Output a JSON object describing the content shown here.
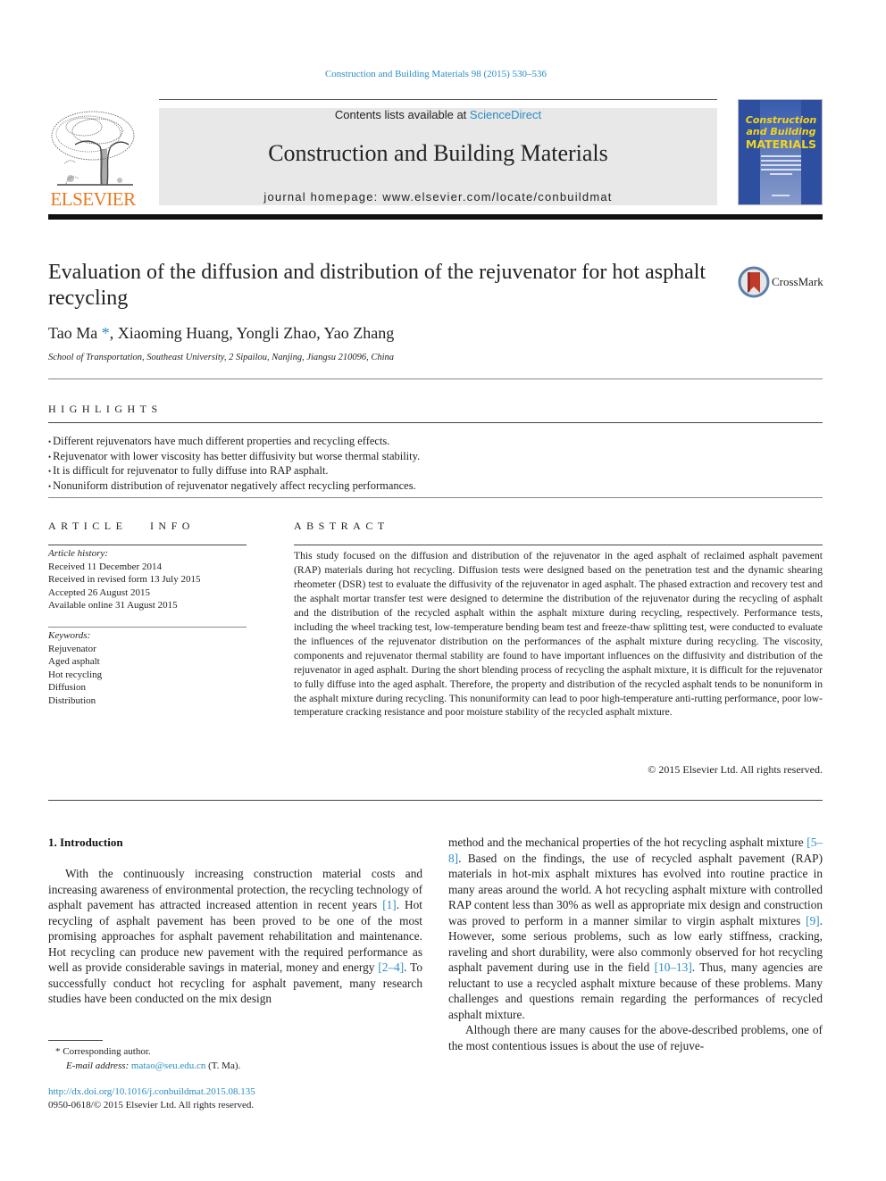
{
  "journal_citation": "Construction and Building Materials 98 (2015) 530–536",
  "header": {
    "publisher_logo_text": "ELSEVIER",
    "contents_prefix": "Contents lists available at ",
    "contents_link": "ScienceDirect",
    "journal_title": "Construction and Building Materials",
    "homepage_label": "journal homepage: ",
    "homepage_url": "www.elsevier.com/locate/conbuildmat",
    "cover_line1": "Construction",
    "cover_line2": "and Building",
    "cover_line3": "MATERIALS"
  },
  "article": {
    "title": "Evaluation of the diffusion and distribution of the rejuvenator for hot asphalt recycling",
    "crossmark_label": "CrossMark",
    "authors_first": "Tao Ma",
    "author_mark": "*",
    "authors_rest": ", Xiaoming Huang, Yongli Zhao, Yao Zhang",
    "affiliation": "School of Transportation, Southeast University, 2 Sipailou, Nanjing, Jiangsu 210096, China"
  },
  "highlights": {
    "heading": "HIGHLIGHTS",
    "items": [
      "Different rejuvenators have much different properties and recycling effects.",
      "Rejuvenator with lower viscosity has better diffusivity but worse thermal stability.",
      "It is difficult for rejuvenator to fully diffuse into RAP asphalt.",
      "Nonuniform distribution of rejuvenator negatively affect recycling performances."
    ]
  },
  "article_info": {
    "heading": "ARTICLE   INFO",
    "history_label": "Article history:",
    "history": [
      "Received 11 December 2014",
      "Received in revised form 13 July 2015",
      "Accepted 26 August 2015",
      "Available online 31 August 2015"
    ],
    "keywords_label": "Keywords:",
    "keywords": [
      "Rejuvenator",
      "Aged asphalt",
      "Hot recycling",
      "Diffusion",
      "Distribution"
    ]
  },
  "abstract": {
    "heading": "ABSTRACT",
    "text": "This study focused on the diffusion and distribution of the rejuvenator in the aged asphalt of reclaimed asphalt pavement (RAP) materials during hot recycling. Diffusion tests were designed based on the pen­etration test and the dynamic shearing rheometer (DSR) test to evaluate the diffusivity of the rejuvenator in aged asphalt. The phased extraction and recovery test and the asphalt mortar transfer test were designed to determine the distribution of the rejuvenator during the recycling of asphalt and the distri­bution of the recycled asphalt within the asphalt mixture during recycling, respectively. Performance tests, including the wheel tracking test, low-temperature bending beam test and freeze-thaw splitting test, were conducted to evaluate the influences of the rejuvenator distribution on the performances of the asphalt mixture during recycling. The viscosity, components and rejuvenator thermal stability are found to have important influences on the diffusivity and distribution of the rejuvenator in aged asphalt. During the short blending process of recycling the asphalt mixture, it is difficult for the rejuvenator to fully diffuse into the aged asphalt. Therefore, the property and distribution of the recycled asphalt tends to be nonuniform in the asphalt mixture during recycling. This nonuniformity can lead to poor high-temperature anti-rutting performance, poor low-temperature cracking resistance and poor moisture sta­bility of the recycled asphalt mixture.",
    "copyright": "© 2015 Elsevier Ltd. All rights reserved."
  },
  "introduction": {
    "heading": "1. Introduction",
    "p1_a": "With the continuously increasing construction material costs and increasing awareness of environmental protection, the recy­cling technology of asphalt pavement has attracted increased attention in recent years ",
    "p1_ref1": "[1]",
    "p1_b": ". Hot recycling of asphalt pavement has been proved to be one of the most promising approaches for asphalt pavement rehabilitation and maintenance. Hot recycling can produce new pavement with the required performance as well as provide considerable savings in material, money and energy ",
    "p1_ref2": "[2–4]",
    "p1_c": ". To successfully conduct hot recycling for asphalt pavement, many research studies have been conducted on the mix design method and the mechanical properties of the hot recycling asphalt mixture ",
    "col1_text": "With the continuously increasing construction material costs and increasing awareness of environmental protection, the recy­cling technology of asphalt pavement has attracted increased attention in recent years",
    "col2_a": "method and the mechanical properties of the hot recycling asphalt mixture ",
    "col2_ref1": "[5–8]",
    "col2_b": ". Based on the findings, the use of recycled asphalt pavement (RAP) materials in hot-mix asphalt mixtures has evolved into routine practice in many areas around the world. A hot recy­cling asphalt mixture with controlled RAP content less than 30% as well as appropriate mix design and construction was proved to perform in a manner similar to virgin asphalt mixtures ",
    "col2_ref2": "[9]",
    "col2_c": ". How­ever, some serious problems, such as low early stiffness, cracking, raveling and short durability, were also commonly observed for hot recycling asphalt pavement during use in the field ",
    "col2_ref3": "[10–13]",
    "col2_d": ". Thus, many agencies are reluctant to use a recycled asphalt mix­ture because of these problems. Many challenges and questions remain regarding the performances of recycled asphalt mixture.",
    "p2": "Although there are many causes for the above-described prob­lems, one of the most contentious issues is about the use of rejuve-",
    "col1_p1": "With the continuously increasing construction material costs and increasing awareness of environmental protection, the recy­cling technology of asphalt pavement has attracted increased attention in recent years ",
    "col1_p2": ". Hot recycling of asphalt pavement has been proved to be one of the most promising approaches for asphalt pavement rehabilitation and maintenance. Hot recycling can produce new pavement with the required performance as well as provide considerable savings in material, money and energy ",
    "col1_p3": ". To successfully conduct hot recycling for asphalt pavement, many research studies have been conducted on the mix design"
  },
  "footnote": {
    "mark": "*",
    "corresponding": " Corresponding author.",
    "email_label": "E-mail address: ",
    "email": "matao@seu.edu.cn",
    "email_suffix": " (T. Ma)."
  },
  "doi": {
    "url": "http://dx.doi.org/10.1016/j.conbuildmat.2015.08.135",
    "issn": "0950-0618/© 2015 Elsevier Ltd. All rights reserved."
  },
  "colors": {
    "link": "#2a8cc4",
    "elsevier_orange": "#e87a1e",
    "cover_blue": "#2e4fa0",
    "cover_yellow": "#f2d51d",
    "crossmark_red": "#c0392b"
  }
}
